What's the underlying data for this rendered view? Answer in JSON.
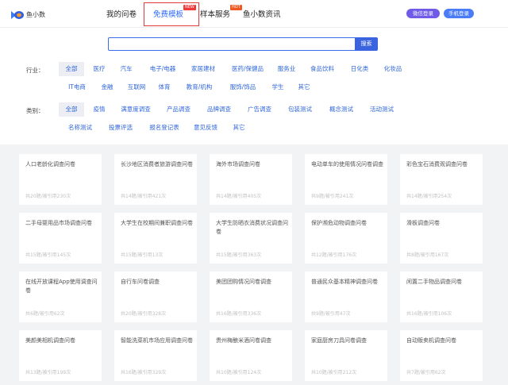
{
  "header": {
    "logo_text": "鱼小数",
    "nav": [
      {
        "label": "我的问卷",
        "badge": ""
      },
      {
        "label": "免费模板",
        "badge": "NEW"
      },
      {
        "label": "样本服务",
        "badge": "HOT"
      },
      {
        "label": "鱼小数资讯",
        "badge": ""
      }
    ],
    "wechat_login": "微信登录",
    "phone_login": "手机登录"
  },
  "search": {
    "placeholder": "",
    "button": "搜索"
  },
  "filters": {
    "industry": {
      "label": "行业：",
      "tags": [
        "全部",
        "医疗",
        "汽车",
        "电子/电器",
        "家居建材",
        "医药/保健品",
        "服务业",
        "食品饮料",
        "日化类",
        "化妆品",
        "IT电商",
        "金融",
        "互联网",
        "体育",
        "教育/机构",
        "服饰/饰品",
        "学生",
        "其它"
      ],
      "selected": "全部"
    },
    "category": {
      "label": "类别：",
      "tags": [
        "全部",
        "疫情",
        "满意度调查",
        "产品调查",
        "品牌调查",
        "广告调查",
        "包装测试",
        "概念测试",
        "活动测试",
        "名称测试",
        "投票评选",
        "报名登记表",
        "意见反馈",
        "其它"
      ],
      "selected": "全部"
    }
  },
  "cards": [
    {
      "title": "人口老龄化调查问卷",
      "stats": "共20题/被引用230次"
    },
    {
      "title": "长沙地区消费者旅游调查问卷",
      "stats": "共14题/被引用421次"
    },
    {
      "title": "海外市场调查问卷",
      "stats": "共14题/被引用405次"
    },
    {
      "title": "电动单车的使用情况问卷调查",
      "stats": "共9题/被引用241次"
    },
    {
      "title": "彩色宝石消费观调查问卷",
      "stats": "共14题/被引用254次"
    },
    {
      "title": "二手母婴用品市场调查问卷",
      "stats": "共15题/被引用145次"
    },
    {
      "title": "大学生在校期间兼职调查问卷",
      "stats": "共15题/被引用13次"
    },
    {
      "title": "大学生防晒衣消费状况调查问卷",
      "stats": "共15题/被引用363次"
    },
    {
      "title": "保护濒危动物调查问卷",
      "stats": "共12题/被引用176次"
    },
    {
      "title": "滑板调查问卷",
      "stats": "共8题/被引用167次"
    },
    {
      "title": "在线开放课程App使用调查问卷",
      "stats": "共6题/被引用62次"
    },
    {
      "title": "自行车问卷调查",
      "stats": "共20题/被引用328次"
    },
    {
      "title": "美团团购情况问卷调查",
      "stats": "共16题/被引用336次"
    },
    {
      "title": "普通民众基本精神调查问卷",
      "stats": "共9题/被引用47次"
    },
    {
      "title": "闲置二手物品调查问卷",
      "stats": "共16题/被引用106次"
    },
    {
      "title": "美颜美相机调查问卷",
      "stats": "共13题/被引用199次"
    },
    {
      "title": "智能洗菜机市场应用调查问卷",
      "stats": "共16题/被引用329次"
    },
    {
      "title": "贵州梅酿米酒问卷调查",
      "stats": "共10题/被引用124次"
    },
    {
      "title": "家庭厨房刀具问卷调查",
      "stats": "共10题/被引用212次"
    },
    {
      "title": "自动贩卖机调查问卷",
      "stats": "共7题/被引用62次"
    }
  ]
}
